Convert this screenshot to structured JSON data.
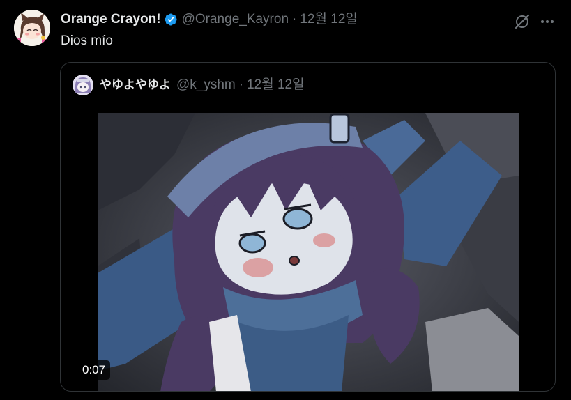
{
  "tweet": {
    "author": {
      "display_name": "Orange Crayon!",
      "handle": "@Orange_Kayron",
      "verified": true,
      "verified_color": "#1d9bf0"
    },
    "separator": "·",
    "date": "12월 12일",
    "text": "Dios mío",
    "icons": {
      "grok": "grok-icon",
      "more": "more-icon"
    }
  },
  "quote": {
    "author": {
      "display_name": "やゆよやゆよ",
      "handle": "@k_yshm"
    },
    "separator": "·",
    "date": "12월 12일",
    "media": {
      "type": "video",
      "duration": "0:07"
    }
  },
  "colors": {
    "background": "#000000",
    "text_primary": "#e7e9ea",
    "text_secondary": "#71767b",
    "border": "#2f3336"
  }
}
